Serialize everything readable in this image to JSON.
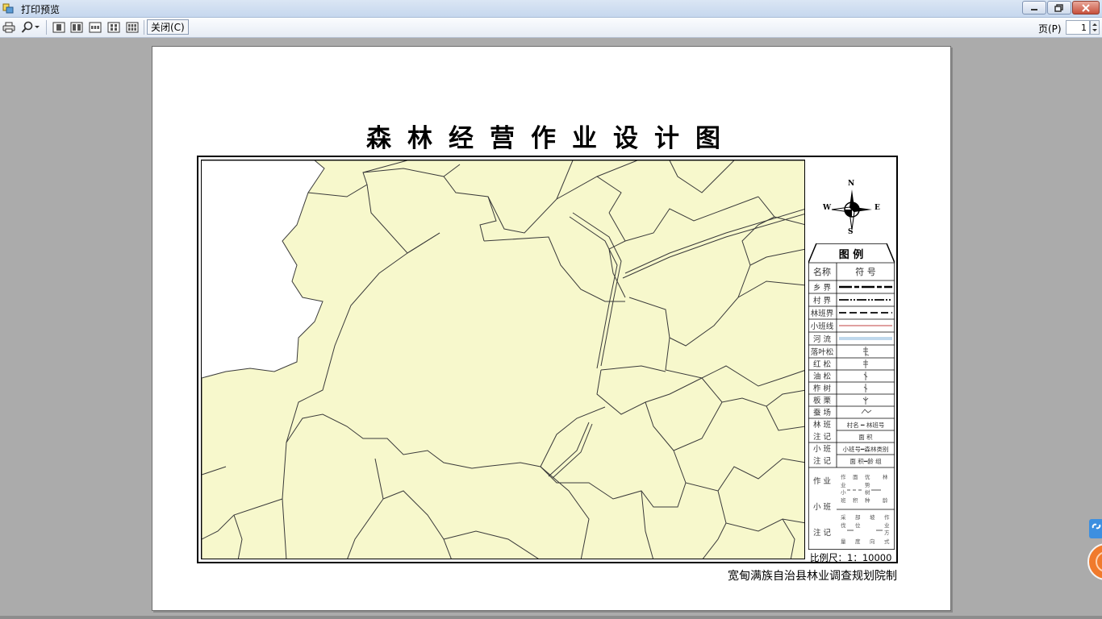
{
  "window": {
    "title": "打印预览",
    "icon": "print-preview-icon"
  },
  "toolbar": {
    "print_icon": "printer-icon",
    "zoom_icon": "magnifier-icon",
    "layouts": [
      "one-page-icon",
      "two-pages-icon",
      "three-pages-icon",
      "four-pages-icon",
      "six-pages-icon"
    ],
    "close_label": "关闭(C)",
    "page_label": "页(P)",
    "page_value": "1"
  },
  "document": {
    "title": "森林经营作业设计图",
    "credit": "宽甸满族自治县林业调查规划院制",
    "compass": {
      "n": "N",
      "s": "S",
      "e": "E",
      "w": "W"
    },
    "scale": "比例尺：1：10000",
    "legend": {
      "title": "图  例",
      "col_name": "名称",
      "col_symbol": "符    号",
      "rows": [
        "乡  界",
        "村  界",
        "林班界",
        "小班线",
        "河  流",
        "落叶松",
        "红  松",
        "油  松",
        "柞  树",
        "板  栗",
        "蚕  场"
      ],
      "lb_label_top": "林  班",
      "lb_label_bottom": "注  记",
      "lb_sym_top": "村名 ━ 林班号",
      "lb_sym_bottom": "面  积",
      "xb_label_top": "小  班",
      "xb_label_bottom": "注  记",
      "xb_sym_top": "小班号━森林类别",
      "xb_sym_bottom": "面 积━龄  组",
      "zy_labels": [
        "作  业",
        "小  班",
        "注  记"
      ]
    },
    "colors": {
      "land": "#f7f8cc",
      "boundary": "#3a3a3a",
      "village_line": "#c04040"
    }
  }
}
